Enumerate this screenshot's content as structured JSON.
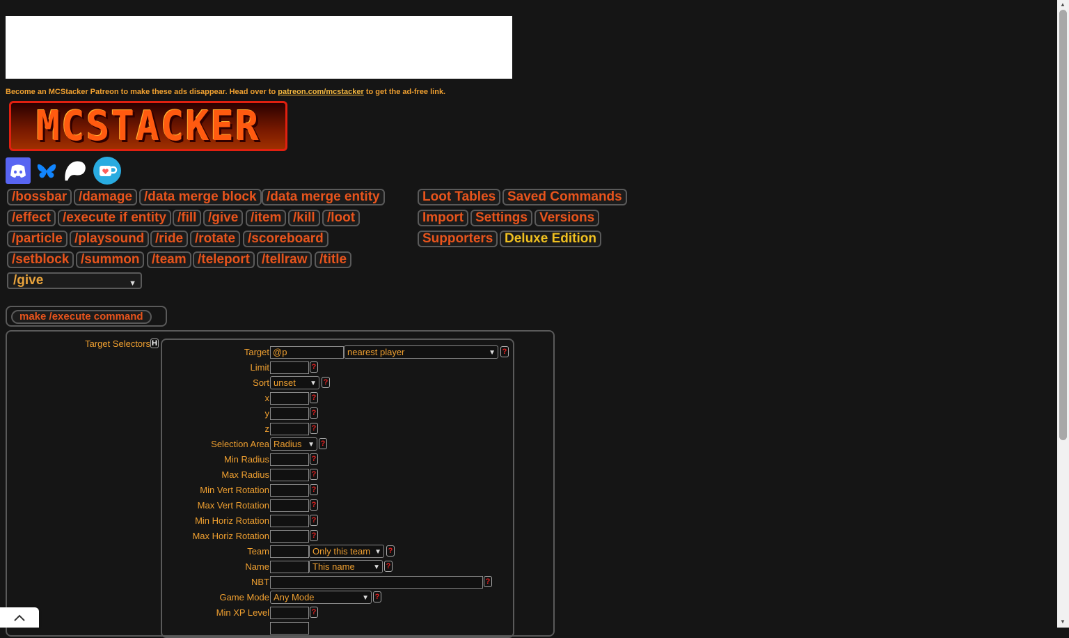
{
  "ad": {
    "note_prefix": "Become an MCStacker Patreon to make these ads disappear. Head over to ",
    "note_link": "patreon.com/mcstacker",
    "note_suffix": " to get the ad-free link."
  },
  "logo": {
    "text": "MCSTACKER"
  },
  "social": [
    "discord-icon",
    "bluesky-icon",
    "patreon-icon",
    "kofi-icon"
  ],
  "commands": {
    "row1": [
      "/bossbar",
      "/damage",
      "/data merge block",
      "/data merge entity"
    ],
    "row2": [
      "/effect",
      "/execute if entity",
      "/fill",
      "/give",
      "/item",
      "/kill",
      "/loot"
    ],
    "row3": [
      "/particle",
      "/playsound",
      "/ride",
      "/rotate",
      "/scoreboard"
    ],
    "row4": [
      "/setblock",
      "/summon",
      "/team",
      "/teleport",
      "/tellraw",
      "/title"
    ]
  },
  "tools": {
    "row1": [
      "Loot Tables",
      "Saved Commands"
    ],
    "row2": [
      "Import",
      "Settings",
      "Versions"
    ],
    "row3": [
      "Supporters",
      "Deluxe Edition"
    ]
  },
  "command_select": {
    "value": "/give"
  },
  "execute_button": "make /execute command",
  "selectors": {
    "section_label": "Target Selectors",
    "h_badge": "H",
    "help": "?",
    "target": {
      "label": "Target",
      "value": "@p",
      "option": "nearest player"
    },
    "limit": {
      "label": "Limit",
      "value": ""
    },
    "sort": {
      "label": "Sort",
      "option": "unset"
    },
    "x": {
      "label": "x",
      "value": ""
    },
    "y": {
      "label": "y",
      "value": ""
    },
    "z": {
      "label": "z",
      "value": ""
    },
    "selection_area": {
      "label": "Selection Area",
      "option": "Radius"
    },
    "min_radius": {
      "label": "Min Radius",
      "value": ""
    },
    "max_radius": {
      "label": "Max Radius",
      "value": ""
    },
    "min_vert_rotation": {
      "label": "Min Vert Rotation",
      "value": ""
    },
    "max_vert_rotation": {
      "label": "Max Vert Rotation",
      "value": ""
    },
    "min_horiz_rotation": {
      "label": "Min Horiz Rotation",
      "value": ""
    },
    "max_horiz_rotation": {
      "label": "Max Horiz Rotation",
      "value": ""
    },
    "team": {
      "label": "Team",
      "value": "",
      "option": "Only this team"
    },
    "name": {
      "label": "Name",
      "value": "",
      "option": "This name"
    },
    "nbt": {
      "label": "NBT",
      "value": ""
    },
    "game_mode": {
      "label": "Game Mode",
      "option": "Any Mode"
    },
    "min_xp_level": {
      "label": "Min XP Level",
      "value": ""
    }
  },
  "colors": {
    "background": "#151515",
    "accent": "#e8541c",
    "label": "#f0a030",
    "deluxe": "#f0c020"
  }
}
